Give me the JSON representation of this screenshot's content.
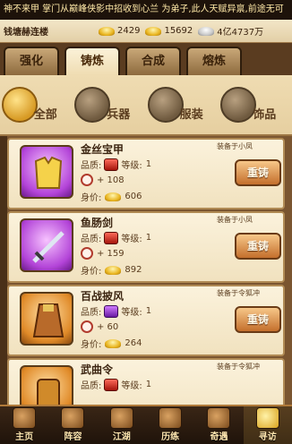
{
  "ticker": "神不来甲 掌门从巅峰侠影中招收到心兰 为弟子,此人天赋异禀,前途无可",
  "status": {
    "location": "钱塘赫连楼",
    "gold": "2429",
    "ingots": "15692",
    "silver": "4亿4737万"
  },
  "tabs": [
    {
      "label": "强化",
      "active": false
    },
    {
      "label": "铸炼",
      "active": true
    },
    {
      "label": "合成",
      "active": false
    },
    {
      "label": "熔炼",
      "active": false
    }
  ],
  "filters": [
    {
      "label": "全部",
      "icon": "all-bag-icon",
      "selected": true
    },
    {
      "label": "兵器",
      "icon": "weapon-icon",
      "selected": false
    },
    {
      "label": "服装",
      "icon": "armor-icon",
      "selected": false
    },
    {
      "label": "饰品",
      "icon": "accessory-icon",
      "selected": false
    }
  ],
  "items": [
    {
      "name": "金丝宝甲",
      "quality_label": "品质:",
      "level_label": "等级:",
      "level": "1",
      "power": "+ 108",
      "value_label": "身价:",
      "value": "606",
      "equipped_to": "装备于小凤",
      "button": "重铸",
      "color": "purple",
      "icon": "golden-armor-icon"
    },
    {
      "name": "鱼肠剑",
      "quality_label": "品质:",
      "level_label": "等级:",
      "level": "1",
      "power": "+ 159",
      "value_label": "身价:",
      "value": "892",
      "equipped_to": "装备于小凤",
      "button": "重铸",
      "color": "purple",
      "icon": "sword-icon"
    },
    {
      "name": "百战披风",
      "quality_label": "品质:",
      "level_label": "等级:",
      "level": "1",
      "power": "+ 60",
      "value_label": "身价:",
      "value": "264",
      "equipped_to": "装备于令狐冲",
      "button": "重铸",
      "color": "orange",
      "icon": "cloak-icon"
    },
    {
      "name": "武曲令",
      "quality_label": "品质:",
      "level_label": "等级:",
      "level": "1",
      "power": "",
      "value_label": "",
      "value": "",
      "equipped_to": "装备于令狐冲",
      "button": "",
      "color": "orange",
      "icon": "token-icon"
    }
  ],
  "bottom_nav": [
    {
      "label": "主页",
      "icon": "home-icon",
      "active": false
    },
    {
      "label": "阵容",
      "icon": "lineup-icon",
      "active": false
    },
    {
      "label": "江湖",
      "icon": "jianghu-icon",
      "active": false
    },
    {
      "label": "历练",
      "icon": "training-icon",
      "active": false
    },
    {
      "label": "奇遇",
      "icon": "adventure-icon",
      "active": false
    },
    {
      "label": "寻访",
      "icon": "search-visit-icon",
      "active": true
    }
  ],
  "colors": {
    "accent": "#c46f2c",
    "panel": "#f1e2bf",
    "dark": "#3a2616"
  }
}
